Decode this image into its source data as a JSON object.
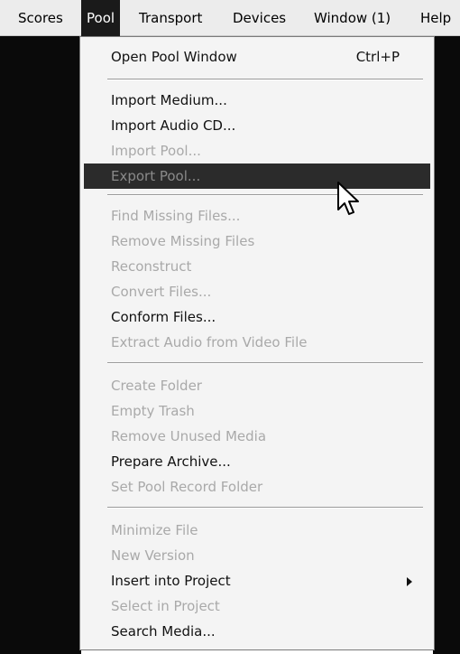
{
  "menubar": {
    "items": [
      {
        "label": "Scores"
      },
      {
        "label": "Pool"
      },
      {
        "label": "Transport"
      },
      {
        "label": "Devices"
      },
      {
        "label": "Window (1)"
      },
      {
        "label": "Help"
      }
    ]
  },
  "pool_menu": {
    "open_pool_window": {
      "label": "Open Pool Window",
      "shortcut": "Ctrl+P"
    },
    "import_medium": {
      "label": "Import Medium..."
    },
    "import_audio_cd": {
      "label": "Import Audio CD..."
    },
    "import_pool": {
      "label": "Import Pool..."
    },
    "export_pool": {
      "label": "Export Pool..."
    },
    "find_missing_files": {
      "label": "Find Missing Files..."
    },
    "remove_missing_files": {
      "label": "Remove Missing Files"
    },
    "reconstruct": {
      "label": "Reconstruct"
    },
    "convert_files": {
      "label": "Convert Files..."
    },
    "conform_files": {
      "label": "Conform Files..."
    },
    "extract_audio": {
      "label": "Extract Audio from Video File"
    },
    "create_folder": {
      "label": "Create Folder"
    },
    "empty_trash": {
      "label": "Empty Trash"
    },
    "remove_unused_media": {
      "label": "Remove Unused Media"
    },
    "prepare_archive": {
      "label": "Prepare Archive..."
    },
    "set_pool_record_folder": {
      "label": "Set Pool Record Folder"
    },
    "minimize_file": {
      "label": "Minimize File"
    },
    "new_version": {
      "label": "New Version"
    },
    "insert_into_project": {
      "label": "Insert into Project"
    },
    "select_in_project": {
      "label": "Select in Project"
    },
    "search_media": {
      "label": "Search Media..."
    }
  }
}
